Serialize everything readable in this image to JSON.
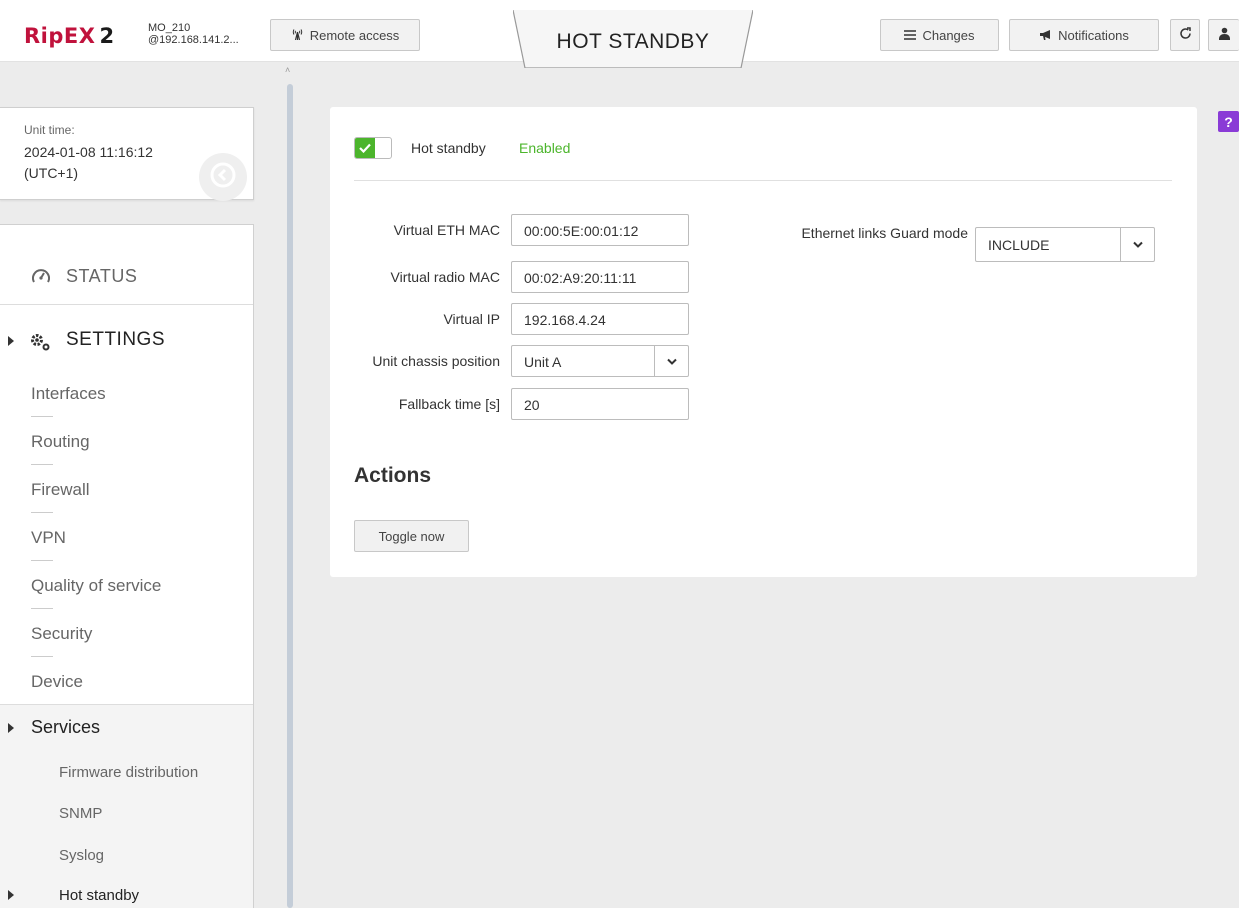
{
  "header": {
    "brand": "RipEX",
    "brand_suffix": "2",
    "unit_name": "MO_210",
    "unit_address": "@192.168.141.2...",
    "remote_access_label": "Remote access",
    "page_title": "HOT STANDBY",
    "changes_label": "Changes",
    "notifications_label": "Notifications",
    "icons": [
      "antenna-icon",
      "list-icon",
      "megaphone-icon",
      "refresh-icon",
      "user-icon"
    ]
  },
  "sidebar": {
    "unit_time_label": "Unit time:",
    "unit_time_value": "2024-01-08 11:16:12 (UTC+1)",
    "status_label": "STATUS",
    "settings_label": "SETTINGS",
    "settings_items": [
      "Interfaces",
      "Routing",
      "Firewall",
      "VPN",
      "Quality of service",
      "Security",
      "Device"
    ],
    "services_label": "Services",
    "services_items": [
      "Firmware distribution",
      "SNMP",
      "Syslog",
      "Hot standby"
    ],
    "active_item": "Hot standby"
  },
  "main": {
    "hot_standby_label": "Hot standby",
    "hot_standby_status": "Enabled",
    "hot_standby_enabled": true,
    "fields": {
      "virtual_eth_mac_label": "Virtual ETH MAC",
      "virtual_eth_mac_value": "00:00:5E:00:01:12",
      "virtual_radio_mac_label": "Virtual radio MAC",
      "virtual_radio_mac_value": "00:02:A9:20:11:11",
      "virtual_ip_label": "Virtual IP",
      "virtual_ip_value": "192.168.4.24",
      "unit_chassis_position_label": "Unit chassis position",
      "unit_chassis_position_value": "Unit A",
      "fallback_time_label": "Fallback time [s]",
      "fallback_time_value": "20",
      "ethernet_guard_label": "Ethernet links Guard mode",
      "ethernet_guard_value": "INCLUDE"
    },
    "actions_heading": "Actions",
    "toggle_now_label": "Toggle now",
    "help_label": "?"
  },
  "colors": {
    "brand": "#c0123c",
    "enabled_green": "#4cb52c",
    "help_purple": "#8a3bd6"
  }
}
